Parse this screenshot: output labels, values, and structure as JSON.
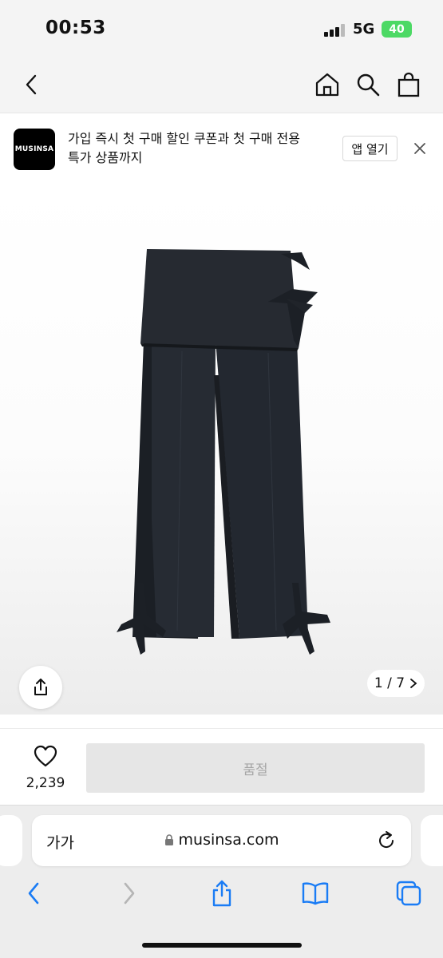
{
  "status_bar": {
    "time": "00:53",
    "network": "5G",
    "battery": "40"
  },
  "nav": {
    "icons": [
      "back-icon",
      "home-icon",
      "search-icon",
      "shopping-bag-icon"
    ]
  },
  "app_banner": {
    "logo_text": "MUSINSA",
    "message_line1": "가입 즉시 첫 구매 할인 쿠폰과 첫 구매 전용",
    "message_line2": "특가 상품까지",
    "open_app_label": "앱 열기"
  },
  "gallery": {
    "counter": "1 / 7"
  },
  "purchase_bar": {
    "like_count": "2,239",
    "button_label": "품절"
  },
  "browser": {
    "text_size_label": "가가",
    "url": "musinsa.com"
  },
  "colors": {
    "brand": "#000000",
    "safari_accent": "#1a7cf5",
    "soldout_bg": "#e6e6e6",
    "soldout_text": "#a6a6a6",
    "battery": "#4cd964"
  }
}
